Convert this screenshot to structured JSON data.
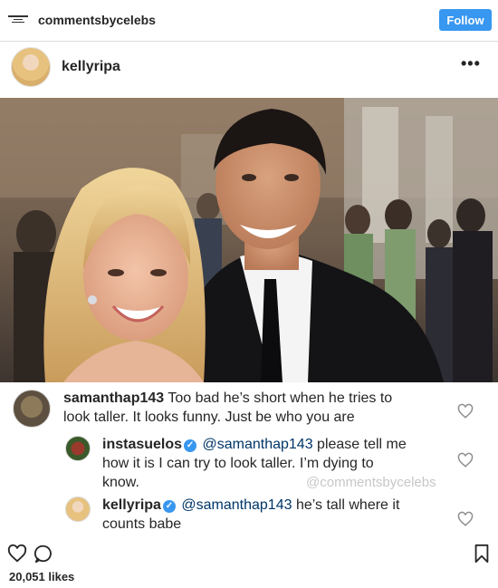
{
  "topbar": {
    "account_name": "commentsbycelebs",
    "follow_label": "Follow",
    "logo_icon": "commentsbycelebs-logo",
    "follow_color": "#3897f0"
  },
  "post": {
    "author": "kellyripa",
    "more_icon": "more-horizontal-icon"
  },
  "comments": [
    {
      "user": "samanthap143",
      "text_line1": "Too bad he’s short when he tries to",
      "text_line2": "look taller. It looks funny. Just be who you are"
    },
    {
      "user": "instasuelos",
      "mention": "@samanthap143",
      "text_line1": "please tell me",
      "text_line2": "how it is I can try to look taller.  I’m dying to",
      "text_line3": "know."
    },
    {
      "user": "kellyripa",
      "mention": "@samanthap143",
      "text_line1": "he’s tall where it",
      "text_line2": "counts babe"
    }
  ],
  "watermark": "@commentsbycelebs",
  "actions": {
    "like_icon": "heart-icon",
    "comment_icon": "comment-icon",
    "save_icon": "bookmark-icon",
    "likes": "20,051 likes"
  },
  "colors": {
    "mention": "#003569",
    "verified": "#3897f0",
    "divider": "#dbdbdb"
  }
}
